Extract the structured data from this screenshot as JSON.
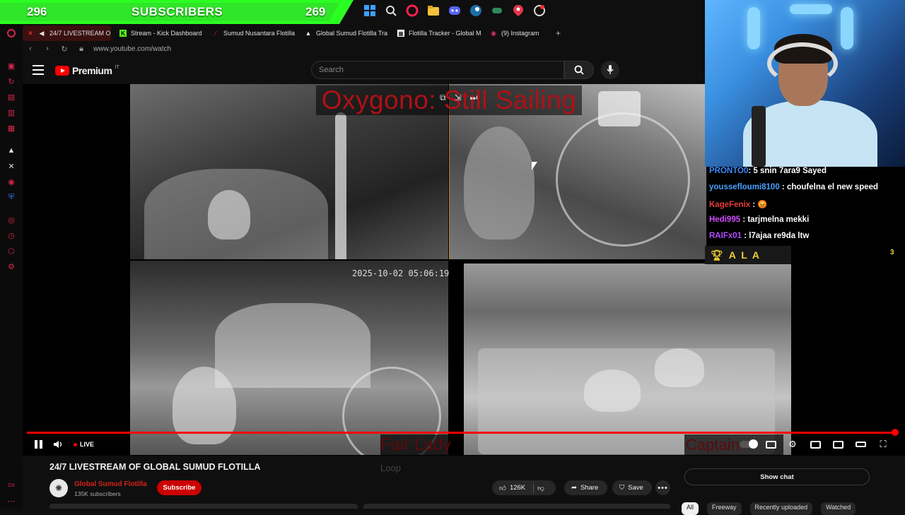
{
  "overlay": {
    "sub_count_left": "296",
    "sub_label": "SUBSCRIBERS",
    "sub_count_right": "269",
    "colors": {
      "bar": "#2bff22",
      "accent": "#ff0000"
    }
  },
  "taskbar": {
    "icons": [
      "windows-icon",
      "search-icon",
      "opera-gx-icon",
      "file-explorer-icon",
      "discord-icon",
      "steam-icon",
      "game-icon",
      "map-pin-icon",
      "clock-icon"
    ]
  },
  "browser": {
    "tabs": [
      {
        "label": "24/7 LIVESTREAM OF",
        "icon": "audio-icon"
      },
      {
        "label": "Stream - Kick Dashboard",
        "icon": "kick-icon"
      },
      {
        "label": "Sumud Nusantara Flotilla",
        "icon": "sumud-icon"
      },
      {
        "label": "Global Sumud Flotilla Tra",
        "icon": "triangle-icon"
      },
      {
        "label": "Flotilla Tracker - Global M",
        "icon": "tracker-icon"
      },
      {
        "label": "(9) Instagram",
        "icon": "instagram-icon"
      }
    ],
    "new_tab": "+",
    "url": "www.youtube.com/watch"
  },
  "youtube": {
    "logo_text": "Premium",
    "logo_sup": "IT",
    "search_placeholder": "Search",
    "video": {
      "cam_title": "Oxygono: Still Sailing",
      "timestamp": "2025-10-02 05:06:19",
      "label_bottom_left": "Fair Lady",
      "label_bottom_left_suffix": "Loop",
      "label_bottom_right": "Captain",
      "live_label": "LIVE",
      "progress": 1.0
    },
    "title": "24/7 LIVESTREAM OF GLOBAL SUMUD FLOTILLA",
    "channel": {
      "name": "Global Sumud Flotilla",
      "subscribers": "135K subscribers",
      "subscribe_label": "Subscribe"
    },
    "actions": {
      "likes": "126K",
      "share": "Share",
      "save": "Save",
      "more": "•••"
    },
    "show_chat": "Show chat",
    "chips": [
      "All",
      "Freeway",
      "Recently uploaded",
      "Watched"
    ]
  },
  "chat": {
    "messages": [
      {
        "user": "PRONTO0",
        "text": ": 5 snin 7ara9 Sayed",
        "color": "#3b8bff"
      },
      {
        "user": "youssefloumi8100",
        "text": ": choufelna el new speed",
        "color": "#4aa0ff"
      },
      {
        "user": "KageFenix",
        "text": " : 😡",
        "color": "#e83a3a"
      },
      {
        "user": "Hedi995",
        "text": ": tarjmelna mekki",
        "color": "#d04cff"
      },
      {
        "user": "RAIFx01",
        "text": ": l7ajaa re9da ltw",
        "color": "#b04cff"
      }
    ],
    "footer_name": "A L A",
    "footer_count": "3"
  }
}
